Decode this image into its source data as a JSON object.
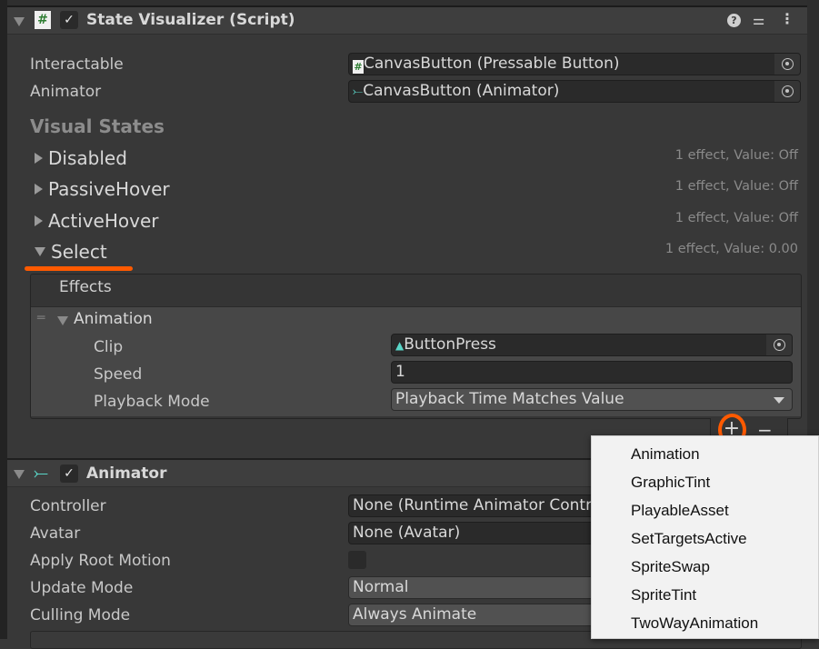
{
  "state_visualizer": {
    "title": "State Visualizer (Script)",
    "enabled": true,
    "interactable_label": "Interactable",
    "interactable_value": "CanvasButton (Pressable Button)",
    "animator_label": "Animator",
    "animator_value": "CanvasButton (Animator)",
    "visual_states_heading": "Visual States",
    "states": [
      {
        "name": "Disabled",
        "summary": "1 effect, Value: Off",
        "expanded": false
      },
      {
        "name": "PassiveHover",
        "summary": "1 effect, Value: Off",
        "expanded": false
      },
      {
        "name": "ActiveHover",
        "summary": "1 effect, Value: Off",
        "expanded": false
      },
      {
        "name": "Select",
        "summary": "1 effect, Value: 0.00",
        "expanded": true
      }
    ],
    "effects": {
      "heading": "Effects",
      "item_title": "Animation",
      "clip_label": "Clip",
      "clip_value": "ButtonPress",
      "speed_label": "Speed",
      "speed_value": "1",
      "playback_label": "Playback Mode",
      "playback_value": "Playback Time Matches Value",
      "add_label": "+",
      "remove_label": "−"
    }
  },
  "animator": {
    "title": "Animator",
    "enabled": true,
    "rows": [
      {
        "label": "Controller",
        "value": "None (Runtime Animator Controller)"
      },
      {
        "label": "Avatar",
        "value": "None (Avatar)"
      },
      {
        "label": "Apply Root Motion",
        "checked": false
      },
      {
        "label": "Update Mode",
        "value": "Normal"
      },
      {
        "label": "Culling Mode",
        "value": "Always Animate"
      }
    ]
  },
  "add_effect_menu": [
    "Animation",
    "GraphicTint",
    "PlayableAsset",
    "SetTargetsActive",
    "SpriteSwap",
    "SpriteTint",
    "TwoWayAnimation"
  ],
  "colors": {
    "highlight": "#ff5a00",
    "animator_icon": "#5ad6c8",
    "script_icon_green": "#2e7d32"
  }
}
